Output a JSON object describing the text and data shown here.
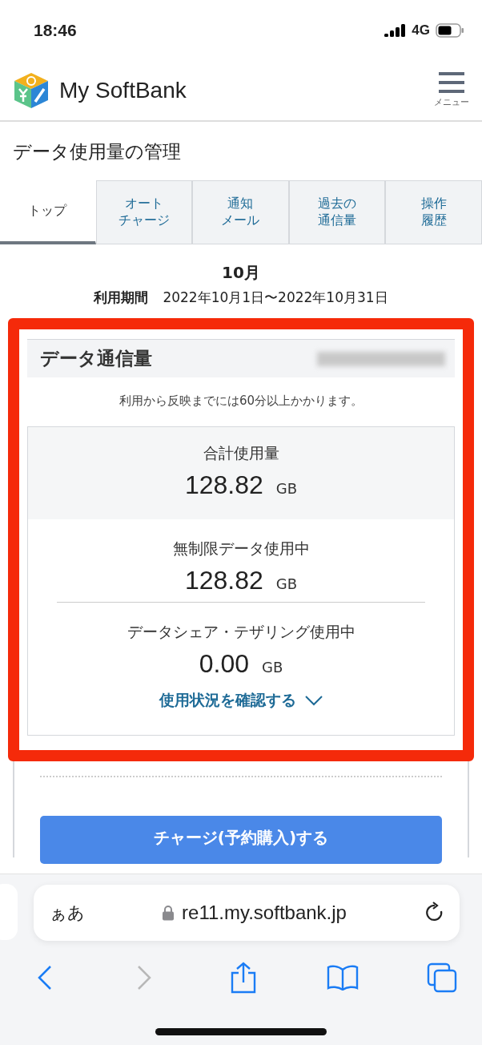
{
  "status_bar": {
    "time": "18:46",
    "network": "4G"
  },
  "header": {
    "title": "My SoftBank",
    "menu_label": "メニュー"
  },
  "page_title": "データ使用量の管理",
  "tabs": [
    {
      "label": "トップ",
      "selected": true
    },
    {
      "label": "オートチャージ",
      "selected": false
    },
    {
      "label": "通知メール",
      "selected": false
    },
    {
      "label": "過去の通信量",
      "selected": false
    },
    {
      "label": "操作履歴",
      "selected": false
    }
  ],
  "period": {
    "month": "10月",
    "label": "利用期間",
    "range": "2022年10月1日〜2022年10月31日"
  },
  "card": {
    "title": "データ通信量",
    "note": "利用から反映までには60分以上かかります。",
    "usage": [
      {
        "kind": "total",
        "label": "合計使用量",
        "value": "128.82",
        "unit": "GB"
      },
      {
        "kind": "detail",
        "label": "無制限データ使用中",
        "value": "128.82",
        "unit": "GB"
      },
      {
        "kind": "detail",
        "label": "データシェア・テザリング使用中",
        "value": "0.00",
        "unit": "GB"
      }
    ],
    "link": "使用状況を確認する"
  },
  "charge_button": "チャージ(予約購入)する",
  "browser": {
    "text_size": "ぁあ",
    "url": "re11.my.softbank.jp",
    "back_disabled": false,
    "forward_disabled": true
  }
}
